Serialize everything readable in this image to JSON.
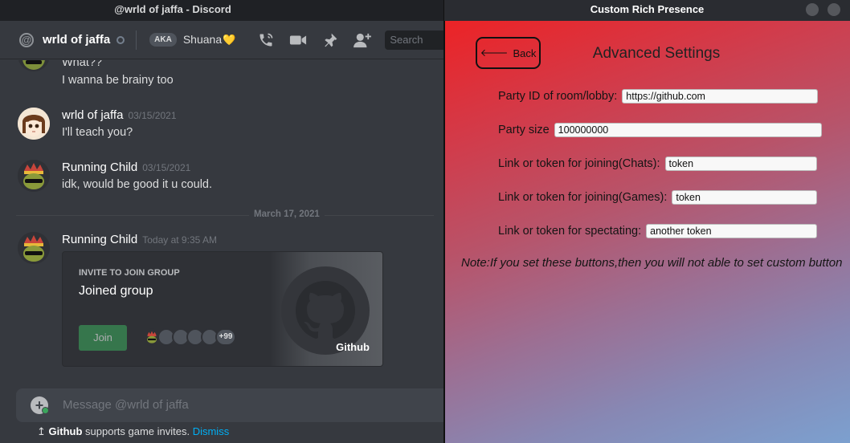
{
  "discord": {
    "window_title": "@wrld of jaffa - Discord",
    "header": {
      "username": "wrld of jaffa",
      "aka_badge": "AKA",
      "aka_name": "Shuana",
      "heart": "💛",
      "search_placeholder": "Search",
      "icons": [
        "at-icon",
        "voice-call-icon",
        "video-call-icon",
        "pin-icon",
        "add-friend-icon"
      ]
    },
    "messages": [
      {
        "text": "What??"
      },
      {
        "text": "I wanna be brainy too"
      },
      {
        "author": "wrld of jaffa",
        "time": "03/15/2021",
        "text": "I'll teach you?"
      },
      {
        "author": "Running Child",
        "time": "03/15/2021",
        "text": "idk, would be good it u could."
      },
      {
        "author": "Running Child",
        "time": "Today at 9:35 AM"
      }
    ],
    "date_divider": "March 17, 2021",
    "invite": {
      "heading": "INVITE TO JOIN GROUP",
      "title": "Joined group",
      "join_label": "Join",
      "more_count": "+99",
      "game_name": "Github"
    },
    "composer_placeholder": "Message @wrld of jaffa",
    "notice": {
      "app": "Github",
      "text": " supports game invites. ",
      "dismiss": "Dismiss"
    }
  },
  "crp": {
    "window_title": "Custom Rich Presence",
    "back_label": "Back",
    "heading": "Advanced Settings",
    "fields": [
      {
        "label": "Party ID of room/lobby:",
        "value": "https://github.com"
      },
      {
        "label": "Party size",
        "value": "100000000"
      },
      {
        "label": "Link or token for joining(Chats):",
        "value": "token"
      },
      {
        "label": "Link or token for joining(Games):",
        "value": "token"
      },
      {
        "label": "Link or token for spectating:",
        "value": "another token"
      }
    ],
    "note": "Note:If you set these buttons,then you will not able to set custom button"
  },
  "colors": {
    "discord_bg": "#36393f",
    "accent_green": "#3ba55c",
    "link_blue": "#00aff4",
    "crp_gradient_start": "#ec2326",
    "crp_gradient_end": "#7ca0cf"
  }
}
